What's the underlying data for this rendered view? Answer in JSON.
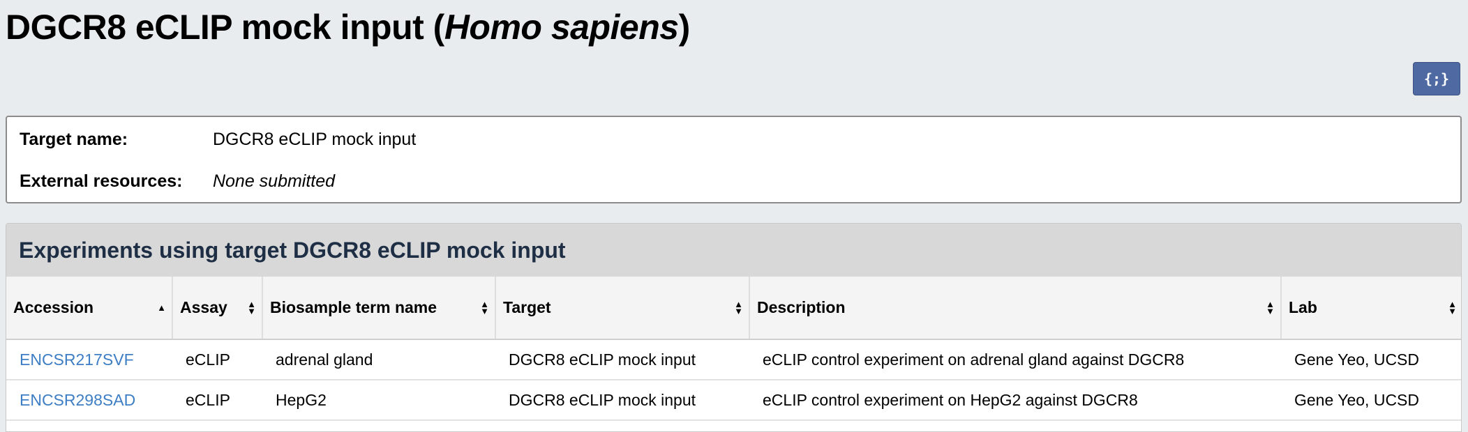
{
  "title": {
    "main": "DGCR8 eCLIP mock input (",
    "species": "Homo sapiens",
    "close": ")"
  },
  "json_button": {
    "label": "{;}"
  },
  "summary": {
    "rows": [
      {
        "key": "Target name:",
        "value": "DGCR8 eCLIP mock input"
      },
      {
        "key": "External resources:",
        "value": "None submitted"
      }
    ]
  },
  "experiments": {
    "heading": "Experiments using target DGCR8 eCLIP mock input",
    "columns": [
      "Accession",
      "Assay",
      "Biosample term name",
      "Target",
      "Description",
      "Lab"
    ],
    "sort": {
      "active_column": "Accession",
      "direction": "ascending"
    },
    "rows": [
      {
        "accession": "ENCSR217SVF",
        "assay": "eCLIP",
        "biosample": "adrenal gland",
        "target": "DGCR8 eCLIP mock input",
        "description": "eCLIP control experiment on adrenal gland against DGCR8",
        "lab": "Gene Yeo, UCSD"
      },
      {
        "accession": "ENCSR298SAD",
        "assay": "eCLIP",
        "biosample": "HepG2",
        "target": "DGCR8 eCLIP mock input",
        "description": "eCLIP control experiment on HepG2 against DGCR8",
        "lab": "Gene Yeo, UCSD"
      }
    ]
  },
  "colors": {
    "background": "#e9ecef",
    "link": "#3d7ec4",
    "json_button": "#4f6aa3",
    "heading_text": "#1e2f45"
  }
}
